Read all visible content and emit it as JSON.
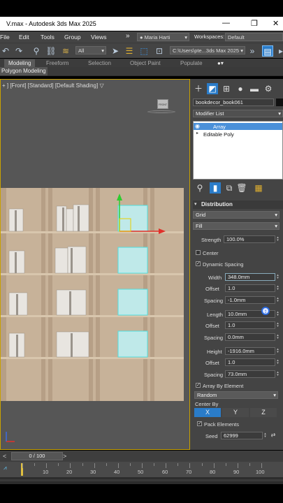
{
  "window": {
    "title": "V.max - Autodesk 3ds Max 2025",
    "minimize": "—",
    "restore": "❐",
    "close": "✕"
  },
  "menu": {
    "items": [
      "File",
      "Edit",
      "Tools",
      "Group",
      "Views"
    ],
    "overflow": "»",
    "user": "Maria Harti",
    "workspaces_label": "Workspaces:",
    "workspaces_value": "Default"
  },
  "toolbar": {
    "selection_filter": "All",
    "path": "C:\\Users\\pte...3ds Max 2025"
  },
  "ribbon": {
    "tabs": [
      "Modeling",
      "Freeform",
      "Selection",
      "Object Paint",
      "Populate"
    ],
    "active_tab": "Modeling",
    "sub_label": "Polygon Modeling"
  },
  "viewport": {
    "label": "+ ] [Front] [Standard] [Default Shading]",
    "filter_symbol": "▽",
    "cube_label": "FRONT"
  },
  "command_panel": {
    "object_name": "bookdecor_book061",
    "modifier_list_label": "Modifier List",
    "stack": [
      {
        "label": "Array",
        "selected": true
      },
      {
        "label": "Editable Poly",
        "selected": false
      }
    ],
    "rollout_title": "Distribution",
    "distribution_type": "Grid",
    "fill_mode": "Fill",
    "strength_label": "Strength",
    "strength_value": "100.0%",
    "center_label": "Center",
    "center_checked": false,
    "dynamic_spacing_label": "Dynamic Spacing",
    "dynamic_spacing_checked": true,
    "width": {
      "label": "Width",
      "value": "348.0mm",
      "offset_label": "Offset",
      "offset": "1.0",
      "spacing_label": "Spacing",
      "spacing": "-1.0mm"
    },
    "length": {
      "label": "Length",
      "value": "10.0mm",
      "offset_label": "Offset",
      "offset": "1.0",
      "spacing_label": "Spacing",
      "spacing": "0.0mm"
    },
    "height": {
      "label": "Height",
      "value": "-1916.0mm",
      "offset_label": "Offset",
      "offset": "1.0",
      "spacing_label": "Spacing",
      "spacing": "73.0mm"
    },
    "array_by_element_label": "Array By Element",
    "array_by_element_checked": true,
    "random_value": "Random",
    "center_by_label": "Center By",
    "axes": [
      "X",
      "Y",
      "Z"
    ],
    "active_axis": "X",
    "pack_elements_label": "Pack Elements",
    "pack_elements_checked": true,
    "seed_label": "Seed",
    "seed_value": "62999"
  },
  "timeline": {
    "frame_display": "0 / 100",
    "ticks": [
      "10",
      "20",
      "30",
      "40",
      "50",
      "60",
      "70",
      "80",
      "90",
      "100"
    ]
  },
  "colors": {
    "accent": "#1e8ae0",
    "viewport_border": "#c9a100",
    "selection_cyan": "#4fe0e0",
    "wood": "#c9b49a"
  }
}
